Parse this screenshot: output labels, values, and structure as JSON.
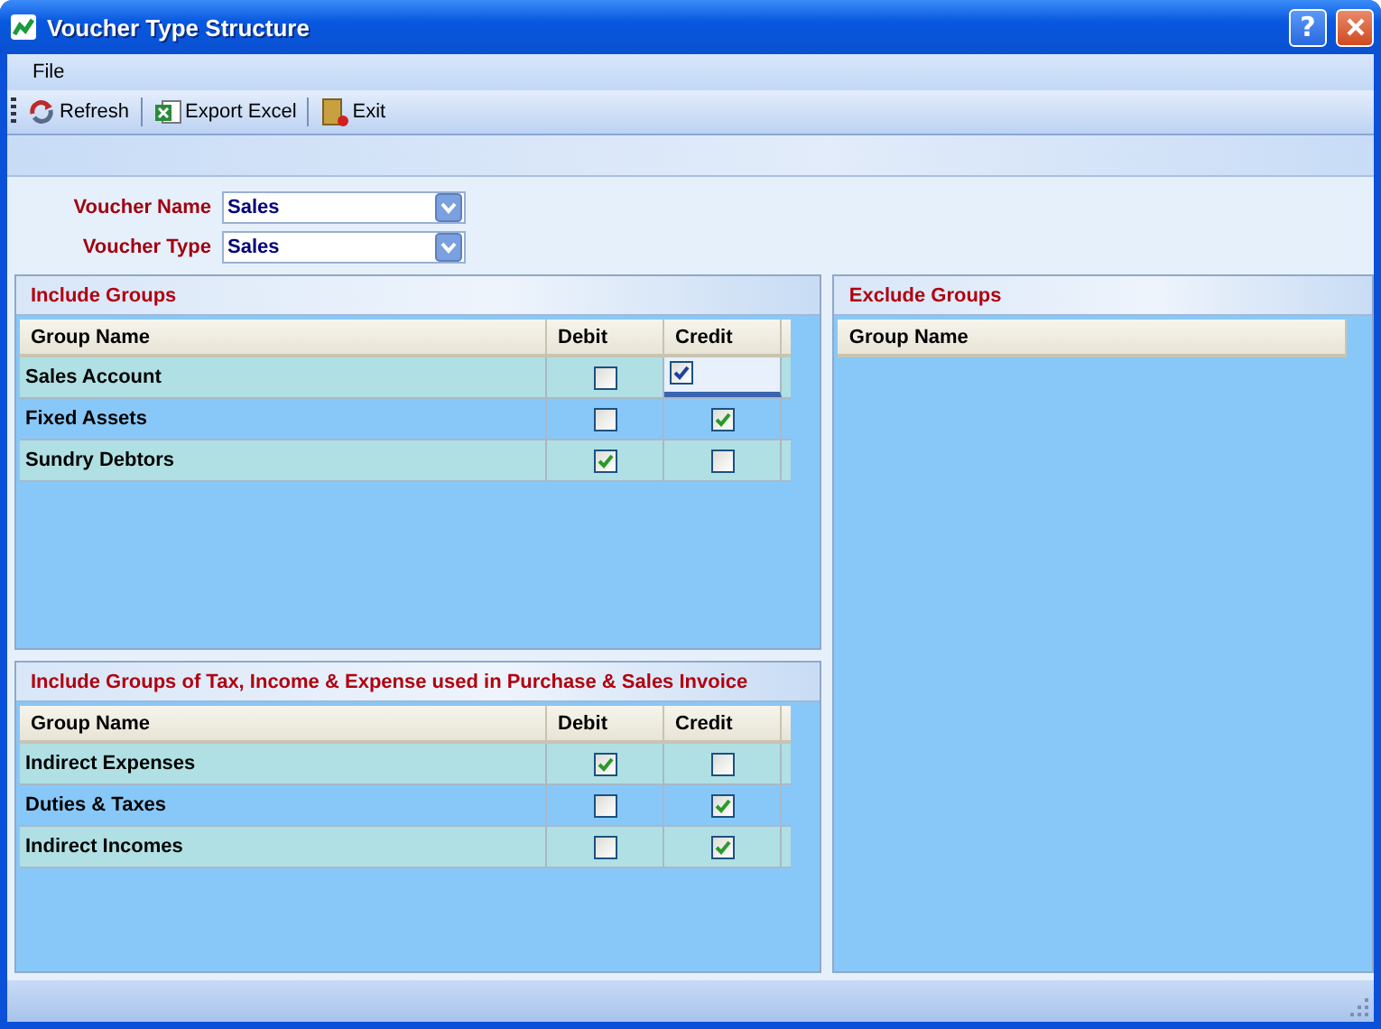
{
  "window": {
    "title": "Voucher Type Structure",
    "help_glyph": "?"
  },
  "menu": [
    "File"
  ],
  "toolbar": [
    {
      "kind": "refresh",
      "label": "Refresh"
    },
    {
      "kind": "excel",
      "label": "Export Excel"
    },
    {
      "kind": "exit",
      "label": "Exit"
    }
  ],
  "form": [
    {
      "label": "Voucher Name",
      "value": "Sales"
    },
    {
      "label": "Voucher Type",
      "value": "Sales"
    }
  ],
  "include_groups": {
    "title": "Include Groups",
    "columns": [
      "Group Name",
      "Debit",
      "Credit"
    ],
    "rows": [
      {
        "name": "Sales Account",
        "debit": false,
        "credit": true,
        "selected": true
      },
      {
        "name": "Fixed Assets",
        "debit": false,
        "credit": true,
        "selected": false
      },
      {
        "name": "Sundry Debtors",
        "debit": true,
        "credit": false,
        "selected": false
      }
    ]
  },
  "tax_groups": {
    "title": "Include Groups of Tax, Income & Expense used in Purchase & Sales Invoice",
    "columns": [
      "Group Name",
      "Debit",
      "Credit"
    ],
    "rows": [
      {
        "name": "Indirect Expenses",
        "debit": true,
        "credit": false,
        "selected": false
      },
      {
        "name": "Duties & Taxes",
        "debit": false,
        "credit": true,
        "selected": false
      },
      {
        "name": "Indirect Incomes",
        "debit": false,
        "credit": true,
        "selected": false
      }
    ]
  },
  "exclude_groups": {
    "title": "Exclude Groups",
    "columns": [
      "Group Name"
    ]
  }
}
